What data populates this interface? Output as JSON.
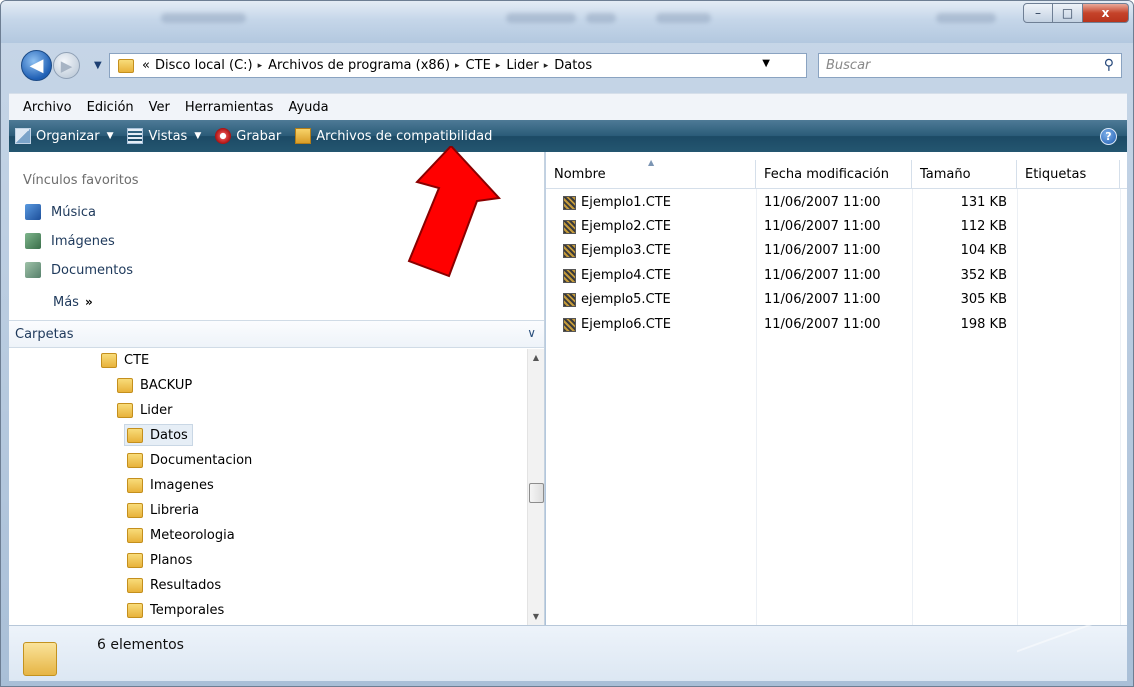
{
  "window": {
    "controls": {
      "minimize": "–",
      "maximize": "□",
      "close": "x"
    }
  },
  "nav": {
    "back_glyph": "◀",
    "forward_glyph": "▶",
    "breadcrumb_prefix": "«",
    "breadcrumbs": [
      "Disco local (C:)",
      "Archivos de programa (x86)",
      "CTE",
      "Lider",
      "Datos"
    ],
    "separator": "▸",
    "search_placeholder": "Buscar"
  },
  "menu": [
    "Archivo",
    "Edición",
    "Ver",
    "Herramientas",
    "Ayuda"
  ],
  "commands": {
    "organizar": "Organizar",
    "vistas": "Vistas",
    "grabar": "Grabar",
    "archivos_compat": "Archivos de compatibilidad",
    "help": "?"
  },
  "favorites": {
    "heading": "Vínculos favoritos",
    "items": [
      "Música",
      "Imágenes",
      "Documentos"
    ],
    "more": "Más",
    "more_glyph": "»"
  },
  "folders": {
    "heading": "Carpetas",
    "tree": [
      {
        "label": "CTE",
        "level": 0,
        "selected": false
      },
      {
        "label": "BACKUP",
        "level": 1,
        "selected": false
      },
      {
        "label": "Lider",
        "level": 1,
        "selected": false
      },
      {
        "label": "Datos",
        "level": 2,
        "selected": true
      },
      {
        "label": "Documentacion",
        "level": 2,
        "selected": false
      },
      {
        "label": "Imagenes",
        "level": 2,
        "selected": false
      },
      {
        "label": "Libreria",
        "level": 2,
        "selected": false
      },
      {
        "label": "Meteorologia",
        "level": 2,
        "selected": false
      },
      {
        "label": "Planos",
        "level": 2,
        "selected": false
      },
      {
        "label": "Resultados",
        "level": 2,
        "selected": false
      },
      {
        "label": "Temporales",
        "level": 2,
        "selected": false
      }
    ]
  },
  "files": {
    "columns": [
      "Nombre",
      "Fecha modificación",
      "Tamaño",
      "Etiquetas"
    ],
    "rows": [
      {
        "name": "Ejemplo1.CTE",
        "date": "11/06/2007 11:00",
        "size": "131 KB"
      },
      {
        "name": "Ejemplo2.CTE",
        "date": "11/06/2007 11:00",
        "size": "112 KB"
      },
      {
        "name": "Ejemplo3.CTE",
        "date": "11/06/2007 11:00",
        "size": "104 KB"
      },
      {
        "name": "Ejemplo4.CTE",
        "date": "11/06/2007 11:00",
        "size": "352 KB"
      },
      {
        "name": "ejemplo5.CTE",
        "date": "11/06/2007 11:00",
        "size": "305 KB"
      },
      {
        "name": "Ejemplo6.CTE",
        "date": "11/06/2007 11:00",
        "size": "198 KB"
      }
    ]
  },
  "status": {
    "count_text": "6 elementos"
  },
  "colors": {
    "command_bar": "#245670",
    "annotation_arrow": "#ff0000",
    "link_text": "#1e395b"
  }
}
